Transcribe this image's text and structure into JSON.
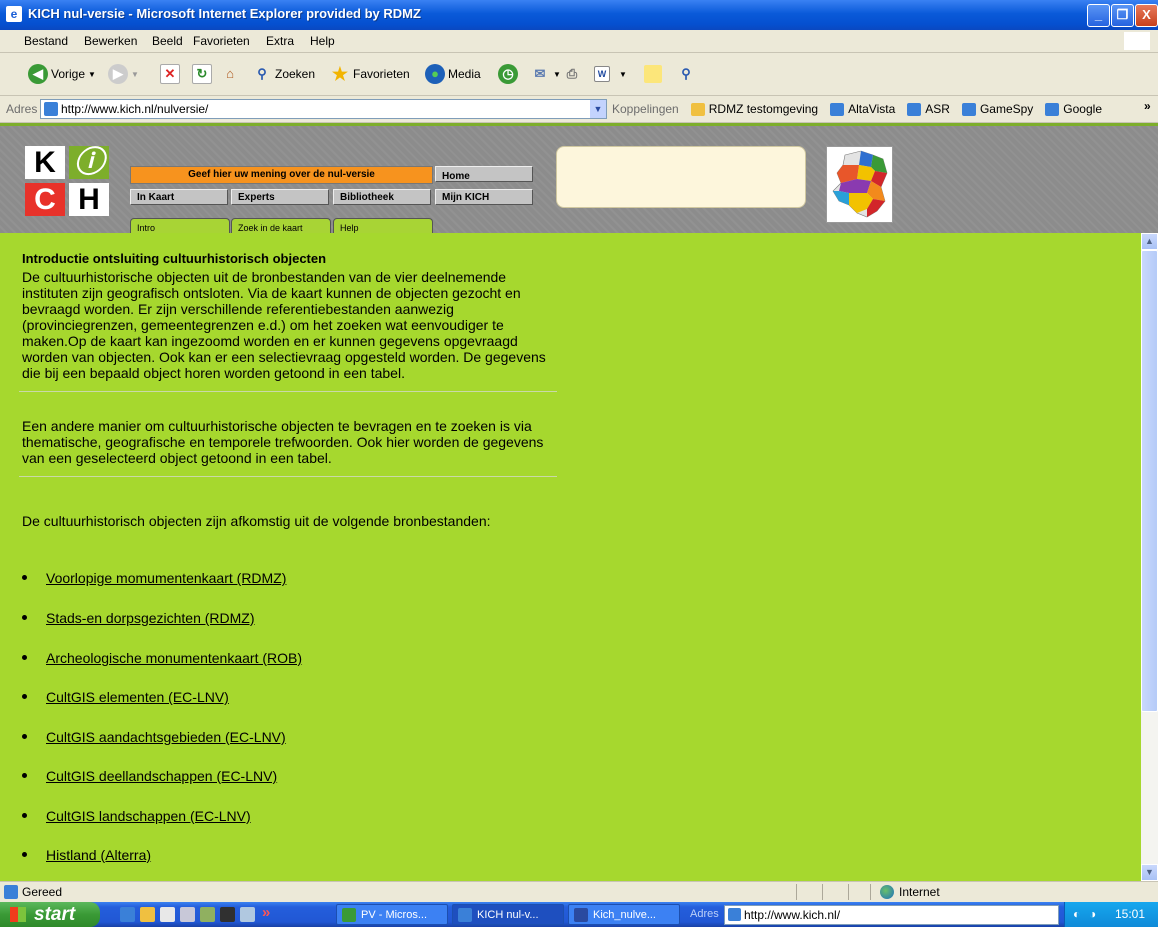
{
  "window": {
    "title": "KICH nul-versie - Microsoft Internet Explorer provided by RDMZ",
    "minimize": "_",
    "maximize": "❐",
    "close": "X"
  },
  "menu": [
    "Bestand",
    "Bewerken",
    "Beeld",
    "Favorieten",
    "Extra",
    "Help"
  ],
  "toolbar": {
    "back": "Vorige",
    "search": "Zoeken",
    "favorites": "Favorieten",
    "media": "Media"
  },
  "address": {
    "label": "Adres",
    "url": "http://www.kich.nl/nulversie/",
    "links_label": "Koppelingen",
    "links": [
      "RDMZ testomgeving",
      "AltaVista",
      "ASR",
      "GameSpy",
      "Google"
    ],
    "more": "»"
  },
  "header": {
    "logo_letters": [
      "K",
      "ⓘ",
      "C",
      "H"
    ],
    "feedback_bar": "Geef hier uw mening over de nul-versie",
    "nav": [
      "Home",
      "In Kaart",
      "Experts",
      "Bibliotheek",
      "Mijn KICH"
    ],
    "tabs": [
      "Intro",
      "Zoek in de kaart",
      "Help"
    ]
  },
  "content": {
    "heading": "Introductie ontsluiting cultuurhistorisch objecten",
    "para1": "De cultuurhistorische objecten uit de bronbestanden van de vier deelnemende instituten zijn geografisch ontsloten. Via de kaart kunnen de objecten gezocht en bevraagd worden. Er zijn verschillende referentiebestanden aanwezig (provinciegrenzen, gemeentegrenzen e.d.) om het zoeken wat eenvoudiger te maken.Op de kaart kan ingezoomd worden en er kunnen gegevens opgevraagd worden van objecten. Ook kan er een selectievraag opgesteld worden. De gegevens die bij een bepaald object horen worden getoond in een tabel.",
    "para2": "Een andere manier om cultuurhistorische objecten te bevragen en te zoeken is via thematische, geografische en temporele trefwoorden. Ook hier worden de gegevens van een geselecteerd object getoond in een tabel.",
    "para3": "De cultuurhistorisch objecten zijn afkomstig uit de volgende bronbestanden:",
    "sources": [
      "Voorlopige momumentenkaart (RDMZ)",
      "Stads-en dorpsgezichten (RDMZ)",
      "Archeologische monumentenkaart (ROB)",
      "CultGIS elementen (EC-LNV)",
      "CultGIS aandachtsgebieden (EC-LNV)",
      "CultGIS deellandschappen (EC-LNV)",
      "CultGIS landschappen (EC-LNV)",
      "Histland (Alterra)"
    ]
  },
  "status": {
    "text": "Gereed",
    "zone": "Internet"
  },
  "taskbar": {
    "start": "start",
    "tasks": [
      "PV - Micros...",
      "KICH nul-v...",
      "Kich_nulve..."
    ],
    "addr_label": "Adres",
    "addr_url": "http://www.kich.nl/",
    "clock": "15:01"
  },
  "colors": {
    "page_green": "#a6d82e",
    "header_gray": "#8c8c8c",
    "feedback_orange": "#f7931e",
    "xp_blue": "#0550d0"
  }
}
